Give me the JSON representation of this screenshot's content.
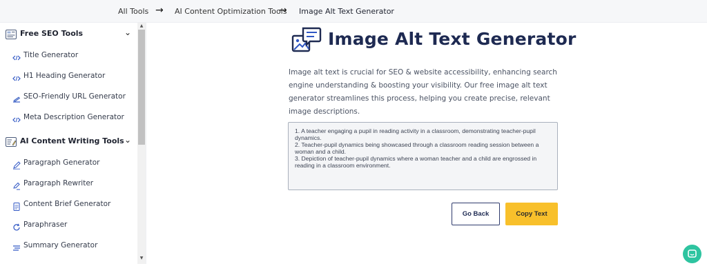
{
  "breadcrumb": {
    "items": [
      "All Tools",
      "AI Content Optimization Tools",
      "Image Alt Text Generator"
    ],
    "separator_icon": "arrow-right-icon"
  },
  "sidebar": {
    "categories": [
      {
        "label": "Free SEO Tools",
        "icon": "seo-tools-icon",
        "expanded_icon": "chevron-down-icon",
        "items": [
          {
            "label": "Title Generator",
            "icon": "code-icon"
          },
          {
            "label": "H1 Heading Generator",
            "icon": "code-icon"
          },
          {
            "label": "SEO-Friendly URL Generator",
            "icon": "url-icon"
          },
          {
            "label": "Meta Description Generator",
            "icon": "code-icon"
          }
        ]
      },
      {
        "label": "AI Content Writing Tools",
        "icon": "content-writing-icon",
        "expanded_icon": "chevron-down-icon",
        "items": [
          {
            "label": "Paragraph Generator",
            "icon": "pen-icon"
          },
          {
            "label": "Paragraph Rewriter",
            "icon": "rewrite-icon"
          },
          {
            "label": "Content Brief Generator",
            "icon": "document-icon"
          },
          {
            "label": "Paraphraser",
            "icon": "refresh-icon"
          },
          {
            "label": "Summary Generator",
            "icon": "summary-icon"
          }
        ]
      }
    ]
  },
  "main": {
    "title": "Image Alt Text Generator",
    "title_icon": "image-chat-icon",
    "intro": "Image alt text is crucial for SEO & website accessibility, enhancing search engine understanding & boosting your visibility. Our free image alt text generator streamlines this process, helping you create precise, relevant image descriptions.",
    "output_lines": [
      "1. A teacher engaging a pupil in reading activity in a classroom, demonstrating teacher-pupil dynamics.",
      "2. Teacher-pupil dynamics being showcased through a classroom reading session between a woman and a child.",
      "3. Depiction of teacher-pupil dynamics where a woman teacher and a child are engrossed in reading in a classroom environment."
    ],
    "go_back_label": "Go Back",
    "copy_text_label": "Copy Text"
  },
  "chat_widget": {
    "icon": "chat-icon"
  },
  "colors": {
    "accent_yellow": "#f8c02b",
    "navy": "#1e2a52",
    "icon_blue": "#2f56c4",
    "chat_green": "#2ec4a0"
  }
}
